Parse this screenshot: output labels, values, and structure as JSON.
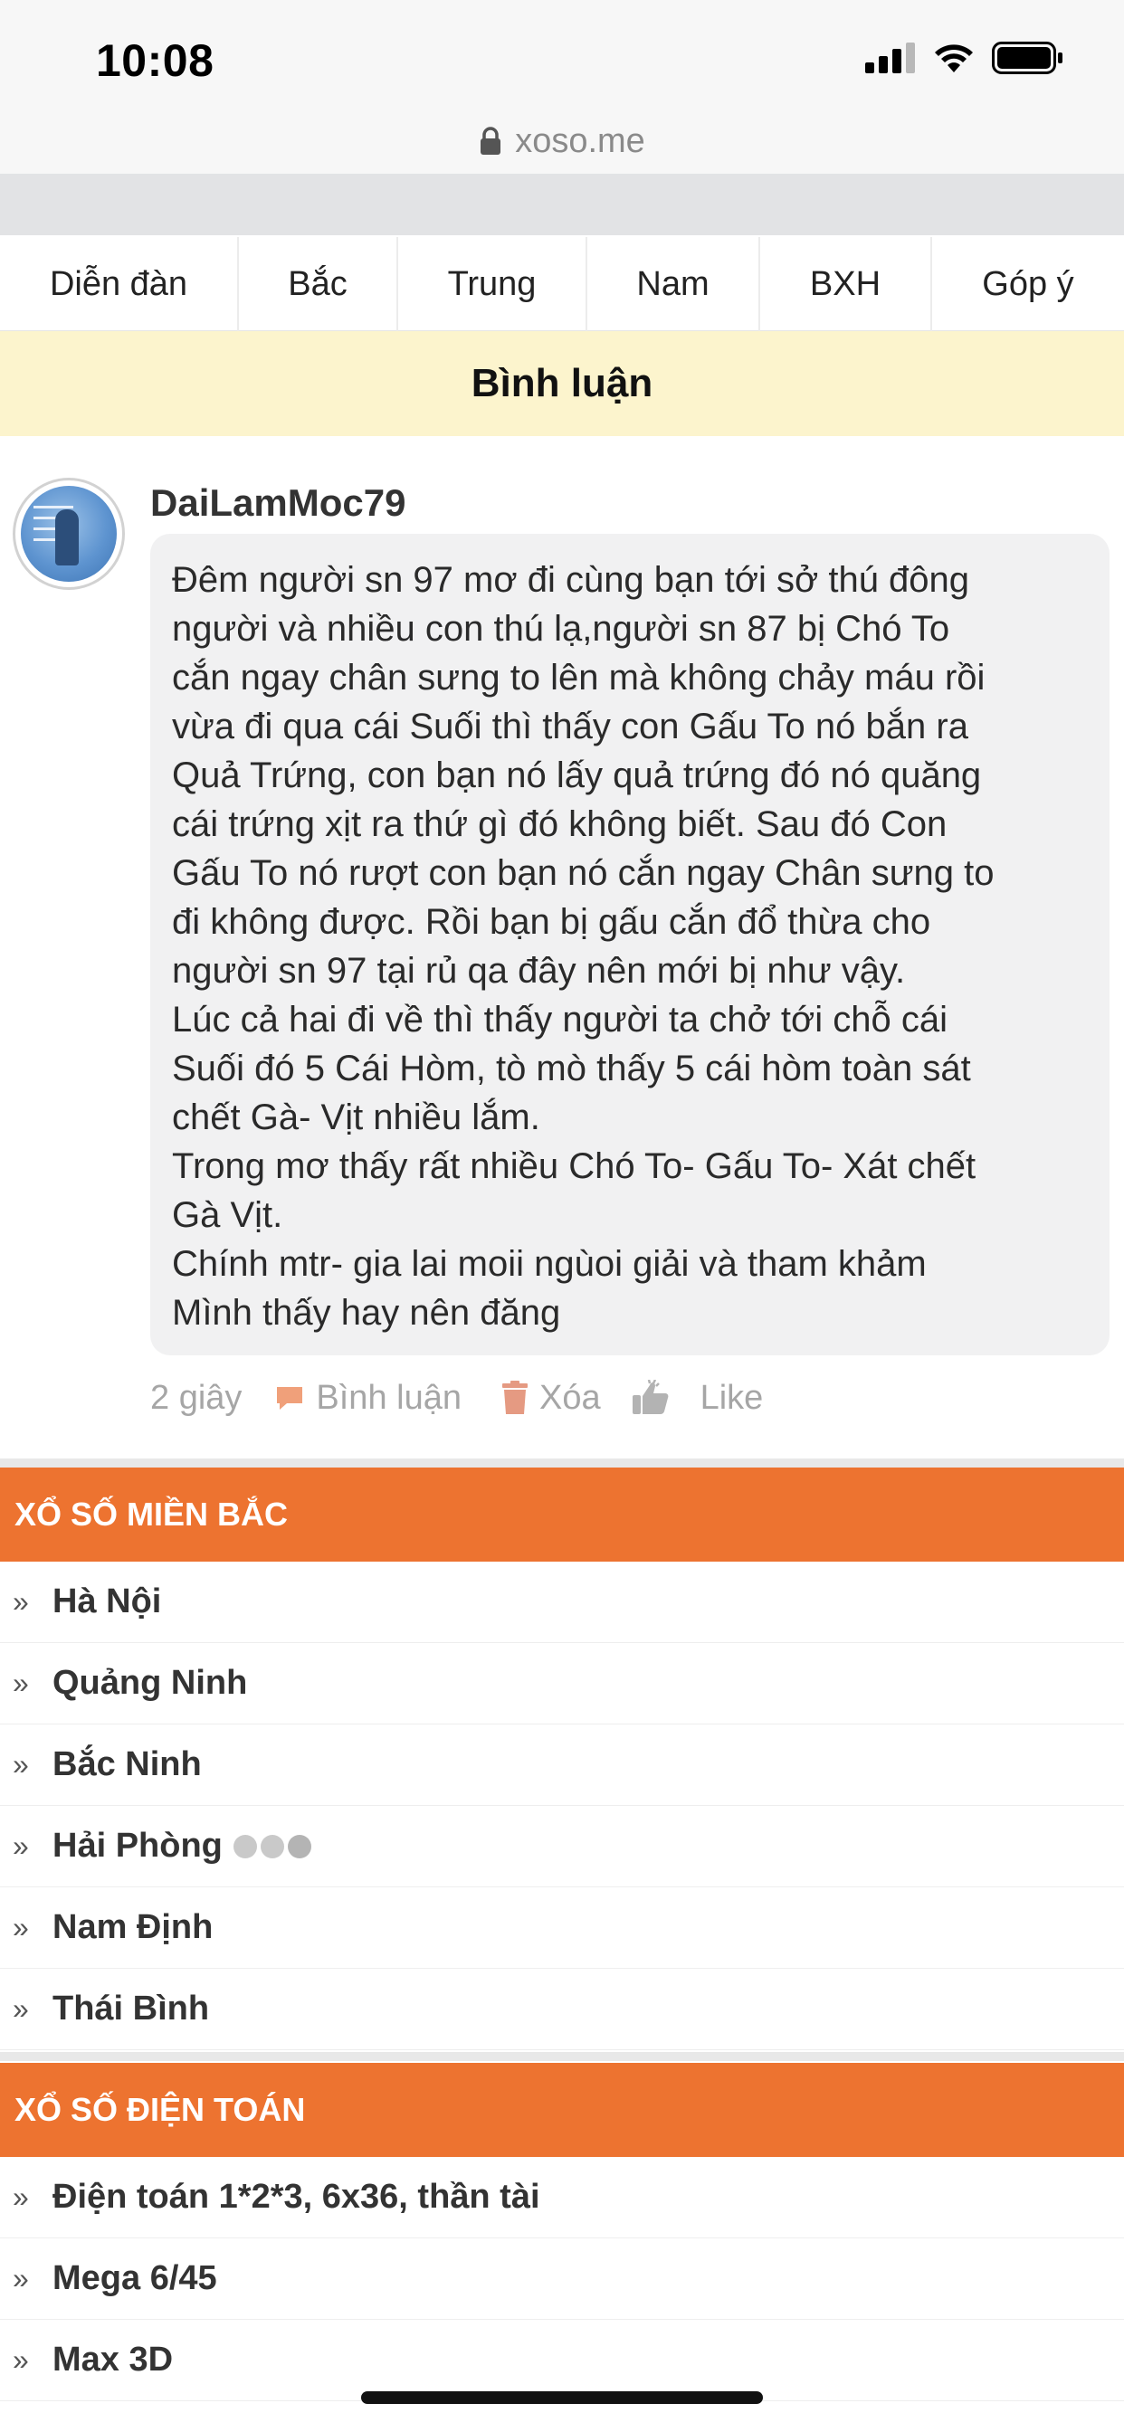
{
  "status_bar": {
    "time": "10:08"
  },
  "browser": {
    "url": "xoso.me"
  },
  "nav": {
    "items": [
      {
        "label": "Diễn đàn"
      },
      {
        "label": "Bắc"
      },
      {
        "label": "Trung"
      },
      {
        "label": "Nam"
      },
      {
        "label": "BXH"
      },
      {
        "label": "Góp ý"
      }
    ]
  },
  "comments_header": {
    "title": "Bình luận"
  },
  "comment": {
    "username": "DaiLamMoc79",
    "lines": [
      "Đêm người sn 97 mơ đi cùng bạn tới sở thú đông",
      "người và nhiều con thú lạ,người sn 87 bị Chó To",
      "cắn ngay chân sưng to lên mà không chảy máu rồi",
      "vừa đi qua cái Suối thì thấy con Gấu To nó bắn ra",
      "Quả Trứng, con bạn nó lấy quả trứng đó nó quăng",
      "cái trứng xịt ra thứ gì đó không biết. Sau đó Con",
      "Gấu To nó rượt con bạn nó cắn ngay Chân sưng to",
      "đi không được. Rồi bạn bị gấu cắn đổ thừa cho",
      "người sn 97 tại rủ qa đây nên mới bị như vậy.",
      "Lúc cả hai đi về thì thấy người ta chở tới chỗ cái",
      "Suối đó 5 Cái Hòm, tò mò thấy 5 cái hòm toàn sát",
      "chết Gà- Vịt nhiều lắm.",
      "Trong mơ thấy rất nhiều Chó To- Gấu To- Xát chết",
      "Gà Vịt.",
      "Chính mtr- gia lai moii ngùoi giải và tham khảm",
      "Mình thấy hay nên đăng"
    ],
    "time_ago": "2 giây",
    "reply_label": "Bình luận",
    "delete_label": "Xóa",
    "like_label": "Like"
  },
  "sections": [
    {
      "title": "XỔ SỐ MIỀN BẮC",
      "items": [
        "Hà Nội",
        "Quảng Ninh",
        "Bắc Ninh",
        "Hải Phòng",
        "Nam Định",
        "Thái Bình"
      ]
    },
    {
      "title": "XỔ SỐ ĐIỆN TOÁN",
      "items": [
        "Điện toán 1*2*3, 6x36, thần tài",
        "Mega 6/45",
        "Max 3D"
      ]
    }
  ],
  "colors": {
    "accent_orange": "#ed7330",
    "header_yellow": "#fcf4cd",
    "bubble_gray": "#f1f1f2",
    "reply_icon": "#f0a07a",
    "delete_icon": "#e59a82"
  },
  "icons": {
    "lock": "lock-icon",
    "signal": "signal-icon",
    "wifi": "wifi-icon",
    "battery": "battery-icon",
    "reply": "speech-bubble-icon",
    "delete": "trash-icon",
    "like": "thumbs-up-icon",
    "chevron": "double-chevron-right-icon",
    "loading": "loading-dots-icon"
  }
}
